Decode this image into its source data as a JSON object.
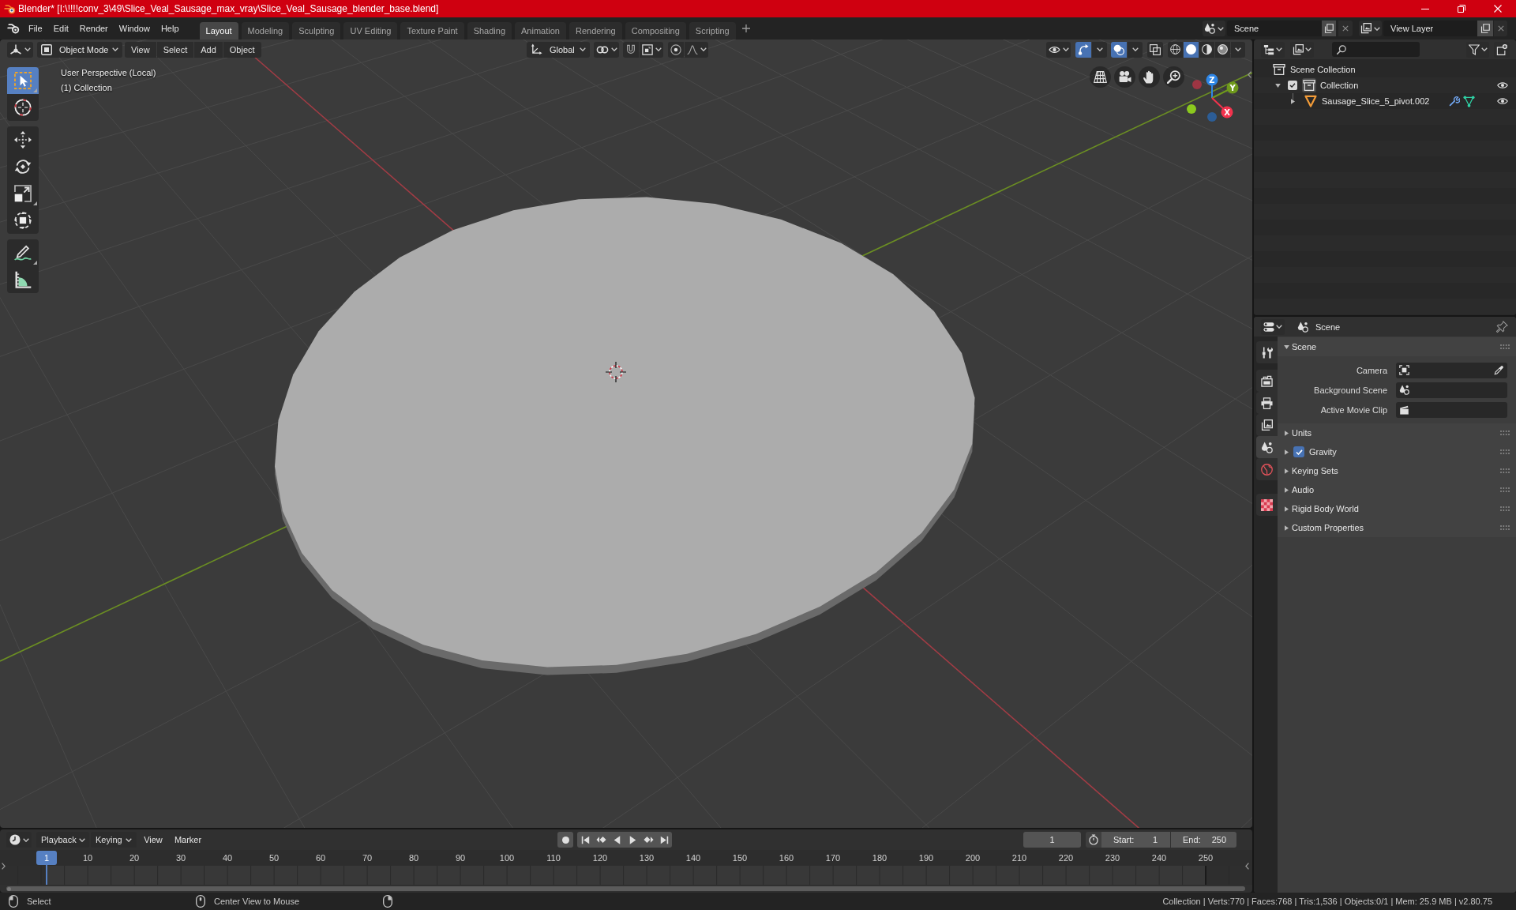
{
  "window": {
    "title": "Blender* [I:\\!!!!conv_3\\49\\Slice_Veal_Sausage_max_vray\\Slice_Veal_Sausage_blender_base.blend]"
  },
  "menu": [
    "File",
    "Edit",
    "Render",
    "Window",
    "Help"
  ],
  "workspaces": [
    {
      "label": "Layout",
      "selected": true
    },
    {
      "label": "Modeling",
      "selected": false
    },
    {
      "label": "Sculpting",
      "selected": false
    },
    {
      "label": "UV Editing",
      "selected": false
    },
    {
      "label": "Texture Paint",
      "selected": false
    },
    {
      "label": "Shading",
      "selected": false
    },
    {
      "label": "Animation",
      "selected": false
    },
    {
      "label": "Rendering",
      "selected": false
    },
    {
      "label": "Compositing",
      "selected": false
    },
    {
      "label": "Scripting",
      "selected": false
    }
  ],
  "scene": {
    "value": "Scene"
  },
  "view_layer": {
    "value": "View Layer"
  },
  "viewport": {
    "mode": "Object Mode",
    "menus": [
      "View",
      "Select",
      "Add",
      "Object"
    ],
    "orientation": "Global",
    "toggles": [
      {
        "kind": "gizmos",
        "on": true
      },
      {
        "kind": "overlays",
        "on": true
      },
      {
        "kind": "xray",
        "on": false
      }
    ],
    "shading": [
      {
        "kind": "wireframe",
        "selected": false
      },
      {
        "kind": "solid",
        "selected": true
      },
      {
        "kind": "material",
        "selected": false
      },
      {
        "kind": "rendered",
        "selected": false
      }
    ],
    "tools": [
      {
        "kind": "select_box",
        "selected": true
      },
      {
        "kind": "cursor",
        "selected": false
      },
      {
        "kind": "move",
        "selected": false
      },
      {
        "kind": "rotate",
        "selected": false
      },
      {
        "kind": "scale",
        "selected": false
      },
      {
        "kind": "transform",
        "selected": false
      },
      {
        "kind": "annotate",
        "selected": false
      },
      {
        "kind": "measure",
        "selected": false
      }
    ],
    "info": [
      "User Perspective (Local)",
      "(1) Collection"
    ],
    "gizmo": [
      {
        "label": "Z",
        "color": "#2e86e6"
      },
      {
        "label": "Y",
        "color": "#6f9a1c"
      },
      {
        "label": "X",
        "color": "#f2334d"
      },
      {
        "color": "#9e3543"
      },
      {
        "color": "#8bc91e"
      },
      {
        "color": "#2c5d96"
      }
    ]
  },
  "outliner": {
    "tree": [
      {
        "label": "Scene Collection",
        "kind": "scene_collection",
        "children": [
          {
            "label": "Collection",
            "kind": "collection",
            "expanded": true,
            "checked": true,
            "visible": true,
            "children": [
              {
                "label": "Sausage_Slice_5_pivot.002",
                "kind": "mesh_object",
                "expanded": false,
                "visible": true
              }
            ]
          }
        ]
      }
    ]
  },
  "properties": {
    "context": "Scene",
    "tabs": [
      {
        "kind": "tool",
        "selected": false
      },
      {
        "kind": "render",
        "selected": false
      },
      {
        "kind": "output",
        "selected": false
      },
      {
        "kind": "view_layer",
        "selected": false
      },
      {
        "kind": "scene",
        "selected": true
      },
      {
        "kind": "world",
        "selected": false
      },
      {
        "kind": "texture",
        "selected": false
      }
    ],
    "panels": [
      {
        "title": "Scene",
        "expanded": true,
        "fields": [
          {
            "label": "Camera",
            "kind": "camera"
          },
          {
            "label": "Background Scene",
            "kind": "scene"
          },
          {
            "label": "Active Movie Clip",
            "kind": "movie_clip"
          }
        ]
      },
      {
        "title": "Units",
        "expanded": false
      },
      {
        "title": "Gravity",
        "expanded": false,
        "checked": true
      },
      {
        "title": "Keying Sets",
        "expanded": false
      },
      {
        "title": "Audio",
        "expanded": false
      },
      {
        "title": "Rigid Body World",
        "expanded": false
      },
      {
        "title": "Custom Properties",
        "expanded": false
      }
    ]
  },
  "timeline": {
    "menus": [
      {
        "label": "Playback",
        "kind": "dropdown"
      },
      {
        "label": "Keying",
        "kind": "dropdown"
      },
      {
        "label": "View",
        "kind": "menu"
      },
      {
        "label": "Marker",
        "kind": "menu"
      }
    ],
    "auto_keying": false,
    "current_frame": "1",
    "start": {
      "label": "Start:",
      "value": "1"
    },
    "end": {
      "label": "End:",
      "value": "250"
    },
    "playhead": "1",
    "ruler": [
      "10",
      "20",
      "30",
      "40",
      "50",
      "60",
      "70",
      "80",
      "90",
      "100",
      "110",
      "120",
      "130",
      "140",
      "150",
      "160",
      "170",
      "180",
      "190",
      "200",
      "210",
      "220",
      "230",
      "240",
      "250"
    ]
  },
  "status_bar": {
    "hints": [
      {
        "kind": "mouse_left",
        "label": "Select"
      },
      {
        "kind": "mouse_middle",
        "label": "Center View to Mouse"
      },
      {
        "kind": "mouse_right"
      }
    ],
    "stats": "Collection | Verts:770 | Faces:768 | Tris:1,536 | Objects:0/1 | Mem: 25.9 MB | v2.80.75"
  }
}
